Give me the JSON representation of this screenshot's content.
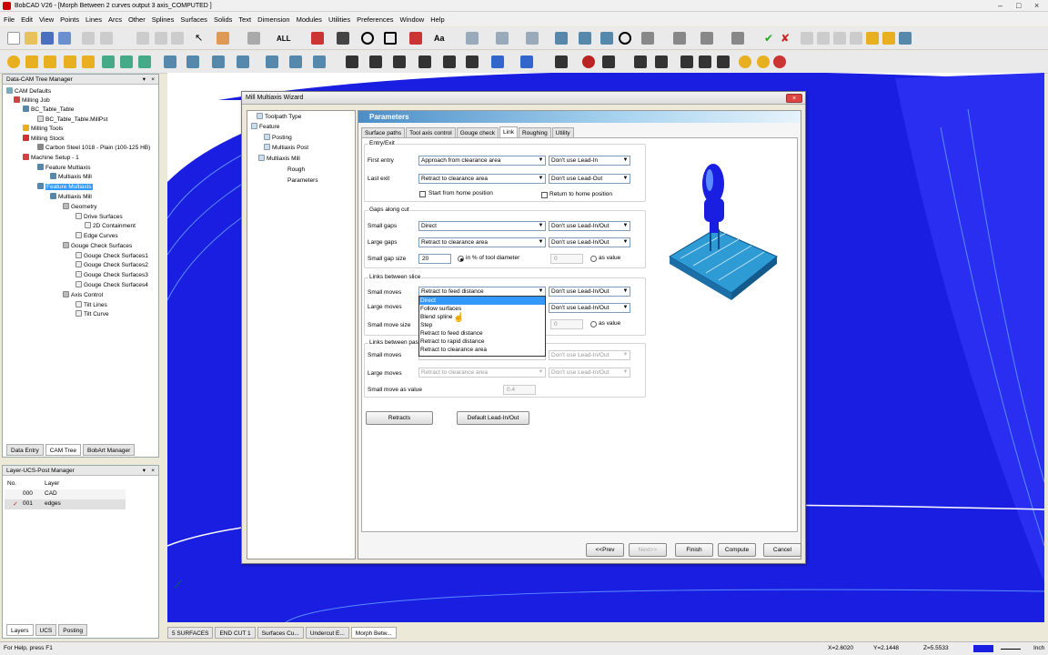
{
  "window": {
    "title": "BobCAD V26 - [Morph Between 2 curves output 3 axis_COMPUTED ]",
    "min": "‒",
    "max": "□",
    "close": "×"
  },
  "menubar": [
    "File",
    "Edit",
    "View",
    "Points",
    "Lines",
    "Arcs",
    "Other",
    "Splines",
    "Surfaces",
    "Solids",
    "Text",
    "Dimension",
    "Modules",
    "Utilities",
    "Preferences",
    "Window",
    "Help"
  ],
  "toolbar": {
    "all_label": "ALL"
  },
  "tree_manager": {
    "title": "Data-CAM Tree Manager",
    "items": [
      "CAM Defaults",
      "Milling Job",
      "BC_Table_Table",
      "BC_Table_Table.MillPst",
      "Milling Tools",
      "Milling Stock",
      "Carbon Steel 1018 - Plain (100-125 HB)",
      "Machine Setup - 1",
      "Feature Multiaxis",
      "Multiaxis Mill",
      "Feature Multiaxis",
      "Multiaxis Mill",
      "Geometry",
      "Drive Surfaces",
      "2D Containment",
      "Edge Curves",
      "Gouge Check Surfaces",
      "Gouge Check Surfaces1",
      "Gouge Check Surfaces2",
      "Gouge Check Surfaces3",
      "Gouge Check Surfaces4",
      "Axis Control",
      "Tilt Lines",
      "Tilt Curve"
    ],
    "tabs": [
      "Data Entry",
      "CAM Tree",
      "BobArt Manager"
    ]
  },
  "layer_manager": {
    "title": "Layer-UCS-Post Manager",
    "col_no": "No.",
    "col_layer": "Layer",
    "rows": [
      {
        "no": "000",
        "name": "CAD"
      },
      {
        "no": "001",
        "name": "edges"
      }
    ],
    "tabs": [
      "Layers",
      "UCS",
      "Posting"
    ]
  },
  "dialog": {
    "title": "Mill Multiaxis Wizard",
    "tree": [
      "Toolpath Type",
      "Feature",
      "Posting",
      "Multiaxis Post",
      "Multiaxis Mill",
      "Rough",
      "Parameters"
    ],
    "header": "Parameters",
    "tabs": [
      "Surface paths",
      "Tool axis control",
      "Gouge check",
      "Link",
      "Roughing",
      "Utility"
    ],
    "entry_exit": {
      "group": "Entry/Exit",
      "first_entry_label": "First entry",
      "first_entry_value": "Approach from clearance area",
      "first_entry_lead": "Don't use Lead-In",
      "last_exit_label": "Last exit",
      "last_exit_value": "Retract to clearance area",
      "last_exit_lead": "Don't use Lead-Out",
      "start_home": "Start from home position",
      "return_home": "Return to home position"
    },
    "gaps": {
      "group": "Gaps along cut",
      "small_label": "Small gaps",
      "small_value": "Direct",
      "small_lead": "Don't use Lead-In/Out",
      "large_label": "Large gaps",
      "large_value": "Retract to clearance area",
      "large_lead": "Don't use Lead-In/Out",
      "size_label": "Small gap size",
      "size_value": "20",
      "pct_label": "in % of tool diameter",
      "abs_value": "0",
      "as_value": "as value"
    },
    "slices": {
      "group": "Links between slice",
      "small_label": "Small moves",
      "small_value": "Retract to feed distance",
      "small_lead": "Don't use Lead-In/Out",
      "large_label": "Large moves",
      "large_lead": "Don't use Lead-In/Out",
      "size_label": "Small move size",
      "abs_value": "0",
      "as_value": "as value"
    },
    "passes": {
      "group": "Links between pas",
      "small_label": "Small moves",
      "small_value": "Direct",
      "small_lead": "Don't use Lead-In/Out",
      "large_label": "Large moves",
      "large_value": "Retract to clearance area",
      "large_lead": "Don't use Lead-In/Out",
      "value_label": "Small move as value",
      "value": "0.4"
    },
    "dropdown_options": [
      "Direct",
      "Follow surfaces",
      "Blend spline",
      "Step",
      "Retract to feed distance",
      "Retract to rapid distance",
      "Retract to clearance area"
    ],
    "retracts_button": "Retracts",
    "default_lead_button": "Default Lead-In/Out",
    "buttons": {
      "prev": "<<Prev",
      "next": "Next>>",
      "finish": "Finish",
      "compute": "Compute",
      "cancel": "Cancel"
    }
  },
  "bottom_tabs": [
    "5 SURFACES",
    "END CUT 1",
    "Surfaces Cu...",
    "Undercut E...",
    "Morph Betw..."
  ],
  "status": {
    "help": "For Help, press F1",
    "x": "X=2.6020",
    "y": "Y=2.1448",
    "z": "Z=5.5533",
    "unit": "Inch"
  },
  "colors": {
    "viewport_blue": "#1a1ee0",
    "header_blue": "#4b8ec8",
    "select": "#3399ff"
  }
}
